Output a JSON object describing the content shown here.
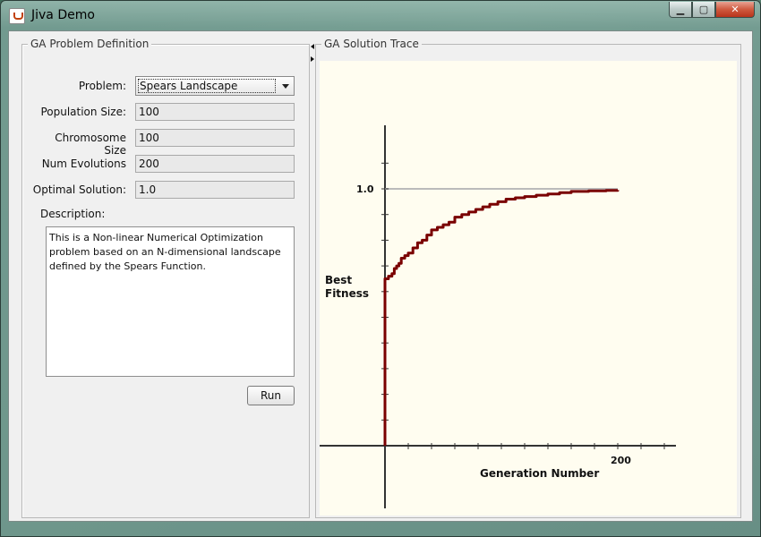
{
  "window": {
    "title": "Jiva Demo",
    "buttons": {
      "minimize": "▁",
      "maximize": "▢",
      "close": "✕"
    }
  },
  "problem_panel": {
    "legend": "GA Problem Definition",
    "fields": {
      "problem": {
        "label": "Problem:",
        "value": "Spears Landscape"
      },
      "population_size": {
        "label": "Population Size:",
        "value": "100"
      },
      "chromosome_size": {
        "label": "Chromosome Size",
        "value": "100"
      },
      "num_evolutions": {
        "label": "Num Evolutions",
        "value": "200"
      },
      "optimal_solution": {
        "label": "Optimal Solution:",
        "value": "1.0"
      }
    },
    "description_label": "Description:",
    "description": "This is a Non-linear Numerical Optimization problem based on an N-dimensional landscape defined by the Spears Function.",
    "run_label": "Run"
  },
  "trace_panel": {
    "legend": "GA Solution Trace"
  },
  "chart_data": {
    "type": "line",
    "xlabel": "Generation Number",
    "ylabel": [
      "Best",
      "Fitness"
    ],
    "x_tick_label": "200",
    "y_tick_label": "1.0",
    "reference_line_y": 1.0,
    "xlim": [
      0,
      200
    ],
    "ylim": [
      0,
      1.0
    ],
    "colors": {
      "series": "#7a0000",
      "reference": "#bbbbbb",
      "axis": "#333333"
    },
    "series": [
      {
        "x": [
          0,
          0,
          3,
          6,
          8,
          10,
          12,
          14,
          17,
          20,
          24,
          28,
          32,
          36,
          40,
          45,
          50,
          55,
          60,
          66,
          72,
          78,
          84,
          90,
          97,
          104,
          112,
          120,
          130,
          140,
          150,
          160,
          175,
          190,
          200
        ],
        "y": [
          0,
          0.65,
          0.66,
          0.67,
          0.69,
          0.7,
          0.71,
          0.73,
          0.74,
          0.75,
          0.77,
          0.79,
          0.8,
          0.82,
          0.84,
          0.85,
          0.86,
          0.87,
          0.89,
          0.9,
          0.91,
          0.92,
          0.93,
          0.94,
          0.95,
          0.96,
          0.965,
          0.97,
          0.975,
          0.98,
          0.985,
          0.99,
          0.992,
          0.994,
          0.995
        ]
      }
    ]
  }
}
